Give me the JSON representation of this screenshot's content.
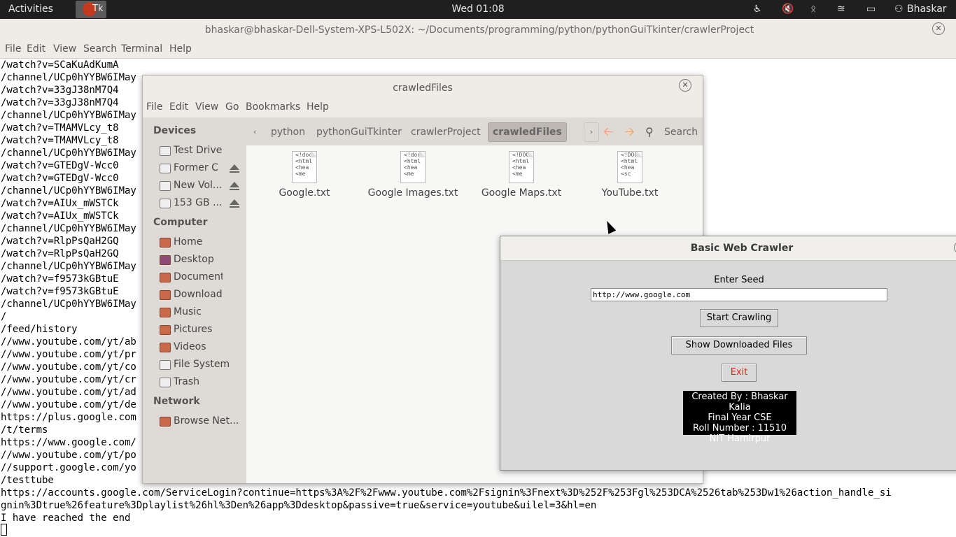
{
  "topbar": {
    "activities": "Activities",
    "task_label": "Tk",
    "clock": "Wed 01:08",
    "user": "Bhaskar"
  },
  "terminal": {
    "title": "bhaskar@bhaskar-Dell-System-XPS-L502X: ~/Documents/programming/python/pythonGuiTkinter/crawlerProject",
    "menu": [
      "File",
      "Edit",
      "View",
      "Search",
      "Terminal",
      "Help"
    ],
    "lines": [
      "/watch?v=SCaKuAdKumA",
      "/channel/UCp0hYYBW6IMay",
      "/watch?v=33gJ38nM7Q4",
      "/watch?v=33gJ38nM7Q4",
      "/channel/UCp0hYYBW6IMay",
      "/watch?v=TMAMVLcy_t8",
      "/watch?v=TMAMVLcy_t8",
      "/channel/UCp0hYYBW6IMay",
      "/watch?v=GTEDgV-Wcc0",
      "/watch?v=GTEDgV-Wcc0",
      "/channel/UCp0hYYBW6IMay",
      "/watch?v=AIUx_mWSTCk",
      "/watch?v=AIUx_mWSTCk",
      "/channel/UCp0hYYBW6IMay",
      "/watch?v=RlpPsQaH2GQ",
      "/watch?v=RlpPsQaH2GQ",
      "/channel/UCp0hYYBW6IMay",
      "/watch?v=f9573kGBtuE",
      "/watch?v=f9573kGBtuE",
      "/channel/UCp0hYYBW6IMay",
      "/",
      "/feed/history",
      "//www.youtube.com/yt/ab",
      "//www.youtube.com/yt/pr",
      "//www.youtube.com/yt/co",
      "//www.youtube.com/yt/cr",
      "//www.youtube.com/yt/ad",
      "//www.youtube.com/yt/de",
      "https://plus.google.com",
      "/t/terms",
      "https://www.google.com/",
      "//www.youtube.com/yt/po",
      "//support.google.com/yo",
      "/testtube",
      "https://accounts.google.com/ServiceLogin?continue=https%3A%2F%2Fwww.youtube.com%2Fsignin%3Fnext%3D%252F%253Fgl%253DCA%2526tab%253Dw1%26action_handle_si",
      "gnin%3Dtrue%26feature%3Dplaylist%26hl%3Den%26app%3Ddesktop&passive=true&service=youtube&uilel=3&hl=en",
      "I have reached the end"
    ]
  },
  "filemanager": {
    "title": "crawledFiles",
    "menu": [
      "File",
      "Edit",
      "View",
      "Go",
      "Bookmarks",
      "Help"
    ],
    "sections": {
      "devices": "Devices",
      "computer": "Computer",
      "network": "Network"
    },
    "devices": [
      "Test Drive",
      "Former C",
      "New Vol...",
      "153 GB ..."
    ],
    "computer": [
      "Home",
      "Desktop",
      "Documents",
      "Downloads",
      "Music",
      "Pictures",
      "Videos",
      "File System",
      "Trash"
    ],
    "network": [
      "Browse Net..."
    ],
    "breadcrumbs": [
      "python",
      "pythonGuiTkinter",
      "crawlerProject",
      "crawledFiles"
    ],
    "search_label": "Search",
    "files": [
      {
        "name": "Google.txt",
        "preview": [
          "<!doc",
          "<html",
          "<hea",
          "<me"
        ]
      },
      {
        "name": "Google Images.txt",
        "preview": [
          "<!doc",
          "<html",
          "<hea",
          "<me"
        ]
      },
      {
        "name": "Google Maps.txt",
        "preview": [
          "<!DOC",
          "<html",
          "<hea",
          "<me"
        ]
      },
      {
        "name": "YouTube.txt",
        "preview": [
          "<!DOC",
          "<html",
          "<hea",
          "<sc"
        ]
      }
    ]
  },
  "crawler": {
    "title": "Basic Web Crawler",
    "seed_label": "Enter Seed",
    "seed_value": "http://www.google.com",
    "start_button": "Start Crawling",
    "show_button": "Show Downloaded Files",
    "exit_button": "Exit",
    "exit_color": "#e0201c",
    "credits": [
      "Created By : Bhaskar Kalia",
      "Final Year CSE",
      "Roll Number : 11510",
      "NIT Hamirpur"
    ]
  }
}
